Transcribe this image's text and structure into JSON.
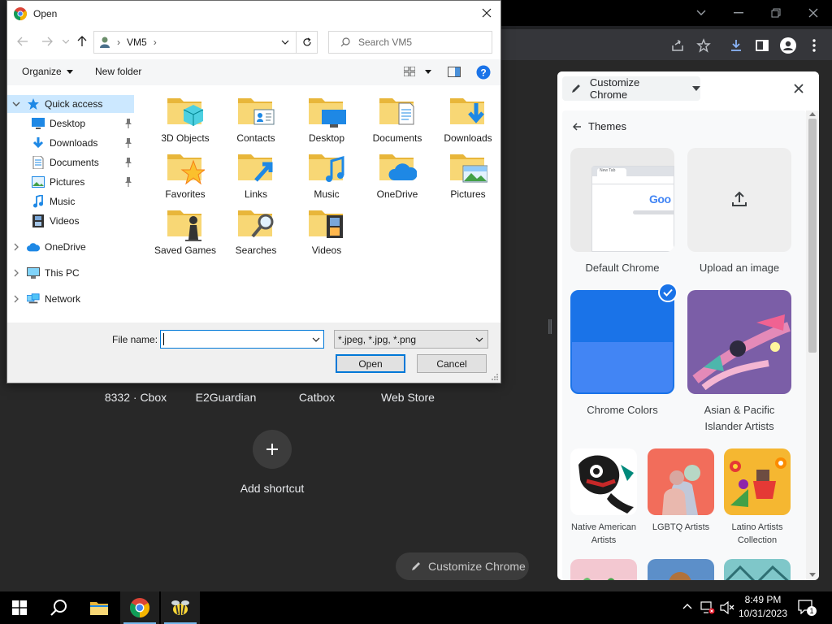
{
  "dialog": {
    "title": "Open",
    "address": {
      "root": "VM5"
    },
    "search_placeholder": "Search VM5",
    "toolbar": {
      "organize": "Organize",
      "new_folder": "New folder"
    },
    "nav_tree": [
      {
        "label": "Quick access",
        "level": 0,
        "expanded": true,
        "selected": true,
        "icon": "star-icon"
      },
      {
        "label": "Desktop",
        "level": 1,
        "pinned": true,
        "icon": "desktop-icon"
      },
      {
        "label": "Downloads",
        "level": 1,
        "pinned": true,
        "icon": "download-arrow-icon"
      },
      {
        "label": "Documents",
        "level": 1,
        "pinned": true,
        "icon": "document-icon"
      },
      {
        "label": "Pictures",
        "level": 1,
        "pinned": true,
        "icon": "picture-icon"
      },
      {
        "label": "Music",
        "level": 1,
        "pinned": false,
        "icon": "music-note-icon"
      },
      {
        "label": "Videos",
        "level": 1,
        "pinned": false,
        "icon": "film-icon"
      },
      {
        "label": "OneDrive",
        "level": 0,
        "expanded": false,
        "icon": "cloud-icon"
      },
      {
        "label": "This PC",
        "level": 0,
        "expanded": false,
        "icon": "computer-icon"
      },
      {
        "label": "Network",
        "level": 0,
        "expanded": false,
        "icon": "network-icon"
      }
    ],
    "folders": [
      {
        "label": "3D Objects",
        "overlay": "cube"
      },
      {
        "label": "Contacts",
        "overlay": "contact"
      },
      {
        "label": "Desktop",
        "overlay": "desktop"
      },
      {
        "label": "Documents",
        "overlay": "document"
      },
      {
        "label": "Downloads",
        "overlay": "download"
      },
      {
        "label": "Favorites",
        "overlay": "star"
      },
      {
        "label": "Links",
        "overlay": "link"
      },
      {
        "label": "Music",
        "overlay": "music"
      },
      {
        "label": "OneDrive",
        "overlay": "cloud"
      },
      {
        "label": "Pictures",
        "overlay": "picture"
      },
      {
        "label": "Saved Games",
        "overlay": "chess"
      },
      {
        "label": "Searches",
        "overlay": "search"
      },
      {
        "label": "Videos",
        "overlay": "film"
      }
    ],
    "file_name_label": "File name:",
    "file_name_value": "",
    "file_type": "*.jpeg, *.jpg, *.png",
    "open_button": "Open",
    "cancel_button": "Cancel"
  },
  "ntp": {
    "shortcuts": [
      "8332 · Cbox",
      "E2Guardian",
      "Catbox",
      "Web Store"
    ],
    "add_shortcut": "Add shortcut",
    "customize_button": "Customize Chrome"
  },
  "side_panel": {
    "dropdown_label": "Customize Chrome",
    "back_label": "Themes",
    "themes": [
      {
        "label": "Default Chrome"
      },
      {
        "label": "Upload an image"
      },
      {
        "label": "Chrome Colors",
        "selected": true
      },
      {
        "label": "Asian & Pacific Islander Artists"
      },
      {
        "label": "Native American Artists"
      },
      {
        "label": "LGBTQ Artists"
      },
      {
        "label": "Latino Artists Collection"
      }
    ],
    "preview_tab": "New Tab",
    "preview_logo": "Goo"
  },
  "taskbar": {
    "time": "8:49 PM",
    "date": "10/31/2023",
    "notification_count": "1"
  },
  "colors": {
    "dialog_accent": "#0078d7",
    "selection": "#cce8ff",
    "chrome_blue": "#1a73e8",
    "folder_yellow": "#f8d775"
  }
}
